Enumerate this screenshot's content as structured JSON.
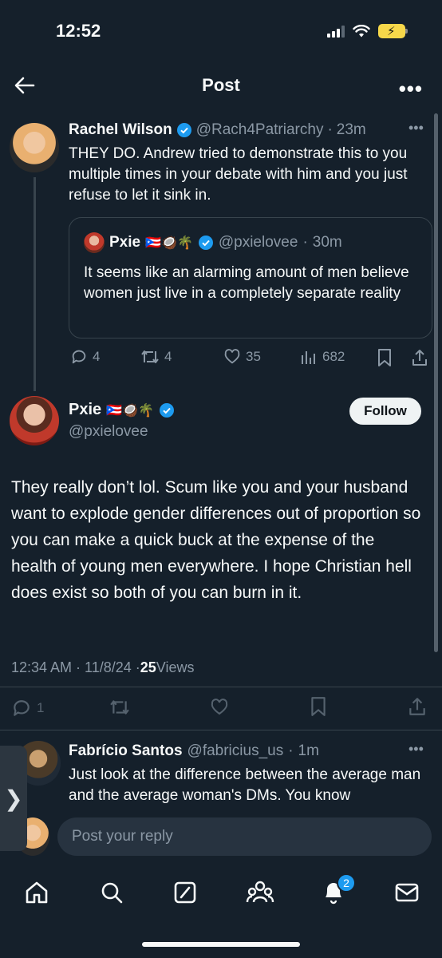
{
  "status_bar": {
    "time": "12:52"
  },
  "header": {
    "title": "Post"
  },
  "parent_tweet": {
    "display_name": "Rachel Wilson",
    "handle": "@Rach4Patriarchy",
    "time": "23m",
    "text": "THEY DO. Andrew tried to demonstrate this to you multiple times in your debate with him and you just refuse to let it sink in.",
    "quote": {
      "display_name": "Pxie",
      "name_emojis": "🇵🇷🥥🌴",
      "handle": "@pxielovee",
      "time": "30m",
      "text": "It seems like an alarming amount of men believe women just live in a completely separate reality"
    },
    "actions": {
      "replies": "4",
      "retweets": "4",
      "likes": "35",
      "views": "682"
    }
  },
  "main_tweet": {
    "display_name": "Pxie",
    "name_emojis": "🇵🇷🥥🌴",
    "handle": "@pxielovee",
    "follow_label": "Follow",
    "text": "They really don’t lol. Scum like you and your husband want to explode gender differences out of proportion so you can make a quick buck at the expense of the health of young men everywhere. I hope Christian hell does exist so both of you can burn in it.",
    "timestamp": "12:34 AM · 11/8/24 · ",
    "views_count": "25",
    "views_label": " Views",
    "actions": {
      "replies": "1"
    }
  },
  "reply_tweet": {
    "display_name": "Fabrício Santos",
    "handle": "@fabricius_us",
    "time": "1m",
    "text": "Just look at the difference between the average man and the average woman's DMs. You know"
  },
  "reply_box": {
    "placeholder": "Post your reply"
  },
  "nav": {
    "notifications_badge": "2"
  },
  "colors": {
    "background": "#15202b",
    "accent": "#1d9bf0",
    "muted": "#8b98a5",
    "divider": "#38444d"
  }
}
